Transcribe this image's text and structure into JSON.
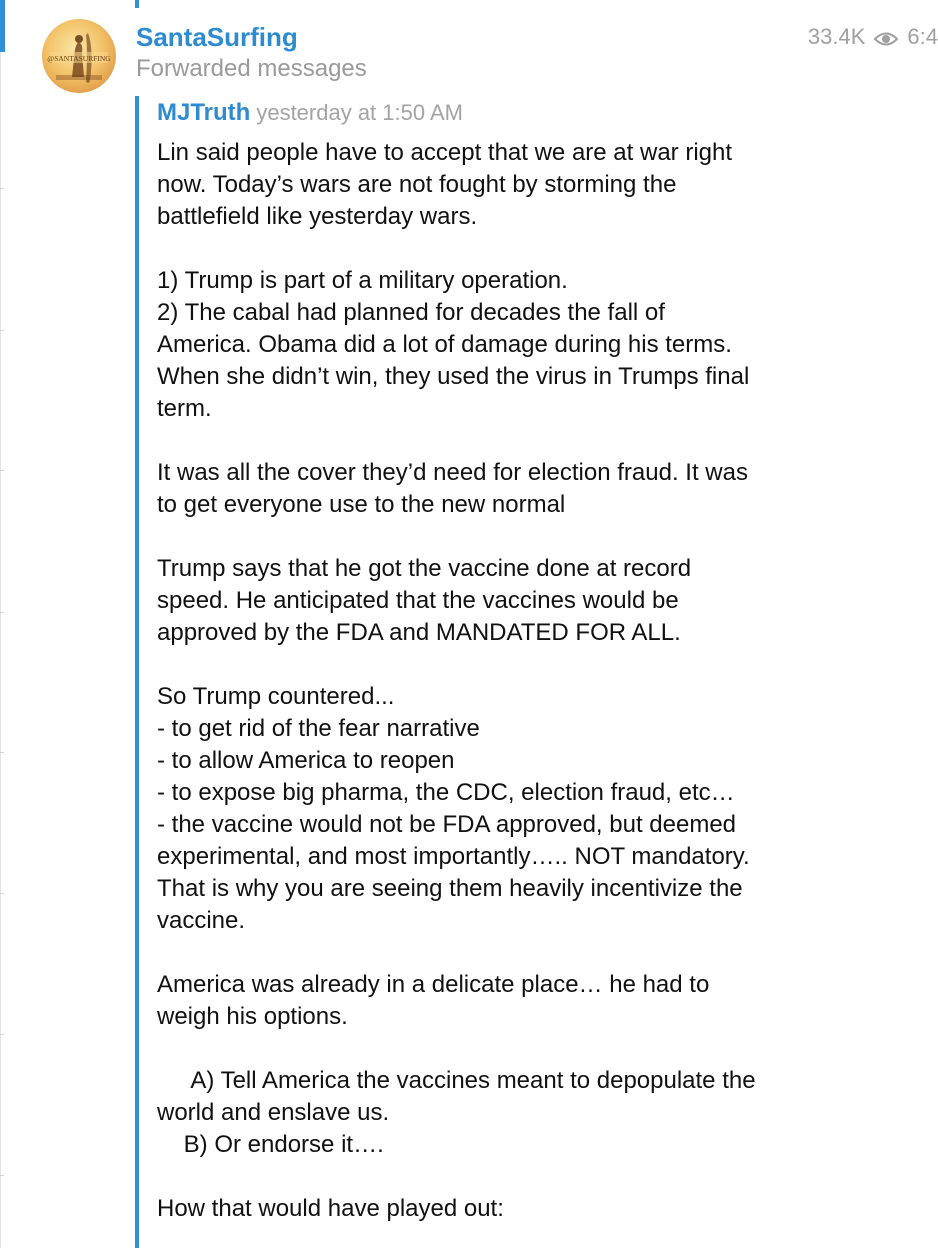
{
  "channel": {
    "name": "SantaSurfing",
    "subtitle": "Forwarded messages",
    "avatar_text": "@SANTASURFING",
    "views": "33.4K",
    "time_partial": "6:4"
  },
  "forward": {
    "author": "MJTruth",
    "time": "yesterday at 1:50 AM"
  },
  "message_lines": [
    "Lin said people have to accept that we are at war right",
    "now. Today’s wars are not fought by storming the",
    "battlefield like yesterday wars.",
    "",
    "1) Trump is part of a military operation.",
    "2) The cabal had planned for decades the fall of",
    "America. Obama did a lot of damage during his terms.",
    "When she didn’t win, they used the virus in Trumps final",
    "term.",
    "",
    "It was all the cover they’d need for election fraud. It was",
    "to get everyone use to the new normal",
    "",
    "Trump says that he got the vaccine done at record",
    "speed. He anticipated that the vaccines would be",
    "approved by the FDA and MANDATED FOR ALL.",
    "",
    "So Trump countered...",
    "- to get rid of the fear narrative",
    "- to allow America to reopen",
    "- to expose big pharma, the CDC, election fraud, etc…",
    "- the vaccine would not be FDA approved, but deemed",
    "experimental, and most importantly….. NOT mandatory.",
    "That is why you are seeing them heavily incentivize the",
    "vaccine.",
    "",
    "America was already in a delicate place… he had to",
    "weigh his options.",
    "",
    "     A) Tell America the vaccines meant to depopulate the",
    "world and enslave us.",
    "    B) Or endorse it….",
    "",
    "How that would have played out:"
  ],
  "icons": {
    "views": "eye-icon"
  },
  "colors": {
    "accent": "#2f8bcf",
    "forward_bar": "#2f8fd8",
    "muted": "#9a9a9a"
  }
}
